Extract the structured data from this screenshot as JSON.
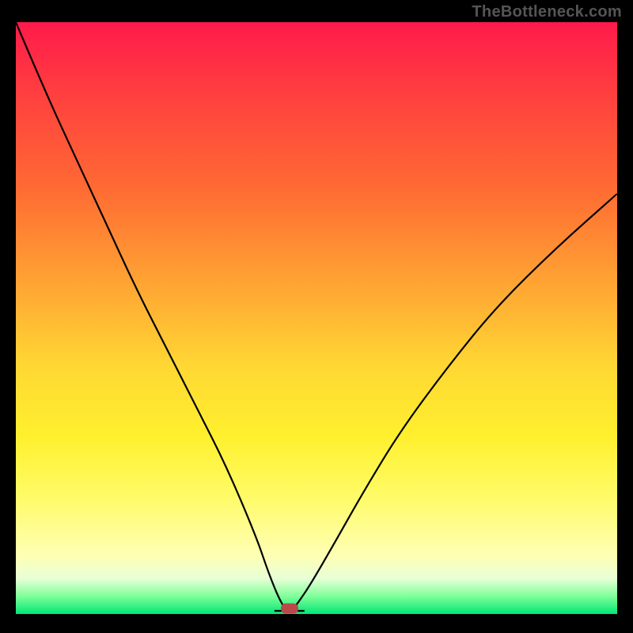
{
  "watermark": "TheBottleneck.com",
  "chart_data": {
    "type": "line",
    "title": "",
    "xlabel": "",
    "ylabel": "",
    "xlim": [
      0,
      100
    ],
    "ylim": [
      0,
      100
    ],
    "x": [
      0,
      5,
      10,
      15,
      20,
      25,
      30,
      35,
      40,
      42,
      44,
      45.5,
      47,
      49,
      53,
      58,
      64,
      72,
      80,
      90,
      100
    ],
    "y": [
      100,
      88,
      77,
      66,
      55,
      45,
      35,
      25,
      13,
      7,
      2,
      0,
      2,
      5,
      12,
      21,
      31,
      42,
      52,
      62,
      71
    ],
    "series": [
      {
        "name": "bottleneck-curve",
        "x": [
          0,
          5,
          10,
          15,
          20,
          25,
          30,
          35,
          40,
          42,
          44,
          45.5,
          47,
          49,
          53,
          58,
          64,
          72,
          80,
          90,
          100
        ],
        "y": [
          100,
          88,
          77,
          66,
          55,
          45,
          35,
          25,
          13,
          7,
          2,
          0,
          2,
          5,
          12,
          21,
          31,
          42,
          52,
          62,
          71
        ]
      }
    ],
    "minimum_point": {
      "x": 45.5,
      "y": 0
    },
    "gradient_stops": [
      {
        "pct": 0,
        "color": "#ff1a4b"
      },
      {
        "pct": 45,
        "color": "#ffa733"
      },
      {
        "pct": 70,
        "color": "#fff02e"
      },
      {
        "pct": 97,
        "color": "#7fff9a"
      },
      {
        "pct": 100,
        "color": "#00e676"
      }
    ],
    "marker_color": "#b94a48"
  }
}
